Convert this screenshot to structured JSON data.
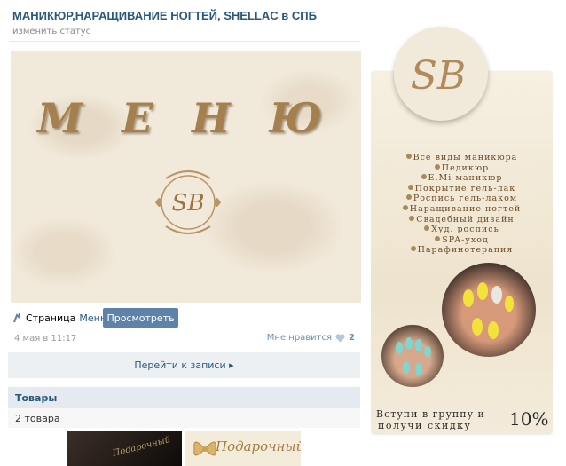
{
  "group": {
    "title": "МАНИКЮР,НАРАЩИВАНИЕ НОГТЕЙ, SHELLAC в СПБ",
    "status": "изменить статус"
  },
  "post": {
    "image_word": "М Е Н Ю",
    "emblem_text": "SB",
    "page_label": "Страница",
    "page_name": "Меню",
    "view_button": "Просмотреть",
    "date": "4 мая в 11:17",
    "like_label": "Мне нравится",
    "like_count": "2",
    "goto_label": "Перейти к записи ▸"
  },
  "goods": {
    "title": "Товары",
    "count": "2 товара",
    "items": [
      {
        "text": "Подарочный"
      }
    ]
  },
  "sidebar_banner": {
    "logo": "SB",
    "menu_items": [
      "Все виды маникюра",
      "Педикюр",
      "E.Mi-маникюр",
      "Покрытие гель-лак",
      "Роспись гель-лаком",
      "Наращивание ногтей",
      "Свадебный дизайн",
      "Худ. роспись",
      "SPA-уход",
      "Парафинотерапия"
    ],
    "promo_line1": "Вступи в группу и",
    "promo_line2": "получи скидку",
    "promo_percent": "10%"
  },
  "colors": {
    "link": "#2b587a",
    "button": "#5e82a8",
    "gold": "#a5804f",
    "cream": "#f1e9da"
  }
}
